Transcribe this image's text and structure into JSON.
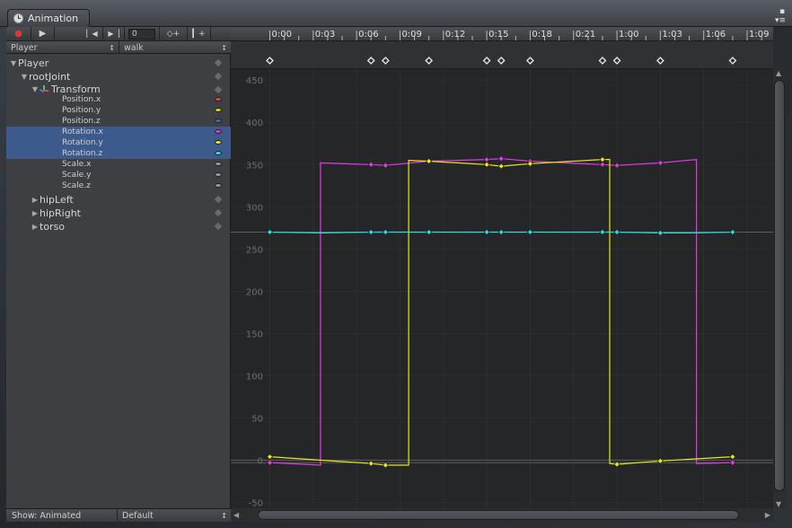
{
  "window": {
    "tab_title": "Animation",
    "menu_glyph": "▪",
    "lock_glyph": "■",
    "tab_menu_glyph": "▾≡"
  },
  "toolbar": {
    "record_icon": "●",
    "play_icon": "▶",
    "prev_key_icon": "▏◀",
    "next_key_icon": "▶▕",
    "frame_value": "0",
    "add_key_icon": "◇+",
    "add_event_icon": "▎+"
  },
  "selectors": {
    "object": "Player",
    "clip": "walk",
    "dropdown_glyph": "↕"
  },
  "hierarchy": [
    {
      "label": "Player",
      "indent": 0,
      "tri": "▼",
      "small": false
    },
    {
      "label": "rootJoint",
      "indent": 1,
      "tri": "▼",
      "small": false
    },
    {
      "label": "Transform",
      "indent": 2,
      "tri": "▼",
      "small": false,
      "icon": true
    },
    {
      "label": "Position.x",
      "indent": 4,
      "small": true,
      "color": "#e04848"
    },
    {
      "label": "Position.y",
      "indent": 4,
      "small": true,
      "color": "#d4d420"
    },
    {
      "label": "Position.z",
      "indent": 4,
      "small": true,
      "color": "#3e6ec0"
    },
    {
      "label": "Rotation.x",
      "indent": 4,
      "small": true,
      "color": "#e03ce0",
      "selected": true
    },
    {
      "label": "Rotation.y",
      "indent": 4,
      "small": true,
      "color": "#e6e620",
      "selected": true
    },
    {
      "label": "Rotation.z",
      "indent": 4,
      "small": true,
      "color": "#30d8e0",
      "selected": true
    },
    {
      "label": "Scale.x",
      "indent": 4,
      "small": true,
      "color": "#9a9a9a"
    },
    {
      "label": "Scale.y",
      "indent": 4,
      "small": true,
      "color": "#9a9a9a"
    },
    {
      "label": "Scale.z",
      "indent": 4,
      "small": true,
      "color": "#9a9a9a"
    },
    {
      "label": "hipLeft",
      "indent": 2,
      "tri": "▶",
      "small": false
    },
    {
      "label": "hipRight",
      "indent": 2,
      "tri": "▶",
      "small": false
    },
    {
      "label": "torso",
      "indent": 2,
      "tri": "▶",
      "small": false
    }
  ],
  "bottom": {
    "show_label": "Show: Animated",
    "mode": "Default"
  },
  "timeline": {
    "labels": [
      "0:00",
      "0:03",
      "0:06",
      "0:09",
      "0:12",
      "0:15",
      "0:18",
      "0:21",
      "1:00",
      "1:03",
      "1:06",
      "1:09"
    ]
  },
  "chart_data": {
    "type": "line",
    "yticks": [
      450,
      400,
      350,
      300,
      250,
      200,
      150,
      100,
      50,
      0,
      -50
    ],
    "ylim": [
      -57,
      463
    ],
    "xlim_frames": [
      -2.7,
      34.8
    ],
    "keyframe_times": [
      0,
      7,
      8,
      11,
      15,
      16,
      18,
      23,
      24,
      27,
      32
    ],
    "series": [
      {
        "name": "Rotation.x",
        "color": "#e03ce0",
        "points": [
          [
            0,
            -3
          ],
          [
            3.5,
            -6
          ],
          [
            3.5,
            352
          ],
          [
            7,
            350
          ],
          [
            8,
            349
          ],
          [
            11,
            354
          ],
          [
            15,
            356
          ],
          [
            16,
            357
          ],
          [
            18,
            354
          ],
          [
            23,
            350
          ],
          [
            24,
            349
          ],
          [
            27,
            352
          ],
          [
            29.5,
            356
          ],
          [
            29.5,
            -4
          ],
          [
            32,
            -3
          ]
        ]
      },
      {
        "name": "Rotation.y",
        "color": "#e6e620",
        "points": [
          [
            0,
            4
          ],
          [
            7,
            -4
          ],
          [
            8,
            -6
          ],
          [
            9.6,
            -6
          ],
          [
            9.6,
            355
          ],
          [
            11,
            354
          ],
          [
            15,
            350
          ],
          [
            16,
            348
          ],
          [
            18,
            351
          ],
          [
            23,
            356
          ],
          [
            23.5,
            356
          ],
          [
            23.5,
            -4
          ],
          [
            24,
            -5
          ],
          [
            27,
            -1
          ],
          [
            32,
            4
          ]
        ]
      },
      {
        "name": "Rotation.z",
        "color": "#30d8e0",
        "points": [
          [
            0,
            270
          ],
          [
            3.5,
            269
          ],
          [
            7,
            270
          ],
          [
            8,
            270
          ],
          [
            11,
            270
          ],
          [
            15,
            270
          ],
          [
            16,
            270
          ],
          [
            18,
            270
          ],
          [
            23,
            270
          ],
          [
            24,
            270
          ],
          [
            27,
            269
          ],
          [
            29,
            269
          ],
          [
            32,
            270
          ]
        ]
      }
    ],
    "series_keys": [
      {
        "series": 0,
        "keys": [
          [
            0,
            -3
          ],
          [
            7,
            350
          ],
          [
            8,
            349
          ],
          [
            11,
            354
          ],
          [
            15,
            356
          ],
          [
            16,
            357
          ],
          [
            18,
            354
          ],
          [
            23,
            350
          ],
          [
            24,
            349
          ],
          [
            27,
            352
          ],
          [
            32,
            -3
          ]
        ]
      },
      {
        "series": 1,
        "keys": [
          [
            0,
            4
          ],
          [
            7,
            -4
          ],
          [
            8,
            -6
          ],
          [
            11,
            354
          ],
          [
            15,
            350
          ],
          [
            16,
            348
          ],
          [
            18,
            351
          ],
          [
            23,
            356
          ],
          [
            24,
            -5
          ],
          [
            27,
            -1
          ],
          [
            32,
            4
          ]
        ]
      },
      {
        "series": 2,
        "keys": [
          [
            0,
            270
          ],
          [
            7,
            270
          ],
          [
            8,
            270
          ],
          [
            11,
            270
          ],
          [
            15,
            270
          ],
          [
            16,
            270
          ],
          [
            18,
            270
          ],
          [
            23,
            270
          ],
          [
            24,
            270
          ],
          [
            27,
            269
          ],
          [
            32,
            270
          ]
        ]
      }
    ]
  }
}
